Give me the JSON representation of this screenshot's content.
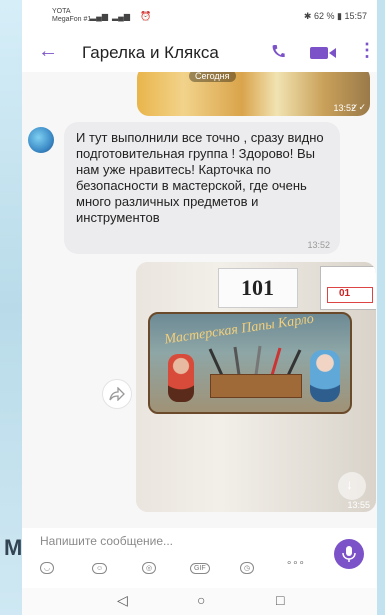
{
  "status": {
    "carrier_top": "YOTA",
    "carrier_bottom": "MegaFon #1",
    "bluetooth": "✱",
    "battery": "62 %",
    "time": "15:57"
  },
  "header": {
    "title": "Гарелка и Клякса"
  },
  "messages": {
    "image_pill": "Сегодня",
    "image_time": "13:52",
    "text": "И тут выполнили все точно , сразу видно подготовительная группа ! Здорово! Вы нам уже нравитесь! Карточка по безопасности в мастерской, где очень много различных предметов и инструментов",
    "text_time": "13:52",
    "photo_time": "13:55",
    "photo_sign": "101",
    "photo_sign_right": "01",
    "plaque_title": "Мастерская Папы Карло"
  },
  "composer": {
    "placeholder": "Напишите сообщение..."
  },
  "toolbar": {
    "sticker": "◡",
    "emoji": "☺",
    "camera": "◎",
    "gif": "GIF",
    "clock": "◷",
    "more": "∘∘∘"
  },
  "nav": {
    "back": "◁",
    "home": "○",
    "recents": "□"
  },
  "overlay": {
    "letter": "М"
  }
}
